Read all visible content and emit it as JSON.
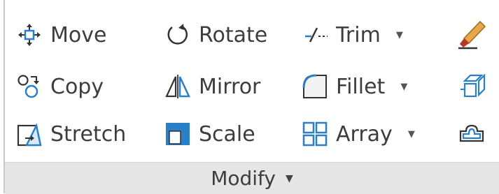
{
  "panel": {
    "footer_label": "Modify",
    "footer_dropdown": "▼"
  },
  "tools": {
    "move": {
      "label": "Move",
      "icon": "move-icon"
    },
    "rotate": {
      "label": "Rotate",
      "icon": "rotate-icon"
    },
    "trim": {
      "label": "Trim",
      "icon": "trim-icon",
      "dropdown": "▼"
    },
    "copy": {
      "label": "Copy",
      "icon": "copy-icon"
    },
    "mirror": {
      "label": "Mirror",
      "icon": "mirror-icon"
    },
    "fillet": {
      "label": "Fillet",
      "icon": "fillet-icon",
      "dropdown": "▼"
    },
    "stretch": {
      "label": "Stretch",
      "icon": "stretch-icon"
    },
    "scale": {
      "label": "Scale",
      "icon": "scale-icon"
    },
    "array": {
      "label": "Array",
      "icon": "array-icon",
      "dropdown": "▼"
    }
  },
  "colors": {
    "icon_blue": "#2a7fc6",
    "icon_dark": "#333333",
    "footer_bg": "#e6e6e6",
    "text": "#3d3d3d"
  }
}
